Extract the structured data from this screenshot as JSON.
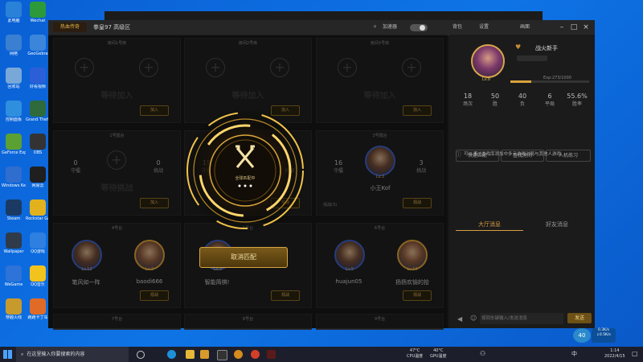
{
  "desktop": {
    "icons": [
      {
        "label": "此电脑",
        "color": "#2a82d8"
      },
      {
        "label": "Wechat",
        "color": "#2c9a3b"
      },
      {
        "label": "网络",
        "color": "#3a7fd1"
      },
      {
        "label": "GeoGebra",
        "color": "#3b86db"
      },
      {
        "label": "回收站",
        "color": "#78a8d8"
      },
      {
        "label": "好看视频",
        "color": "#2b5fd8"
      },
      {
        "label": "控制面板",
        "color": "#2f8fdf"
      },
      {
        "label": "Grand Theft Auto V",
        "color": "#2e6a3b"
      },
      {
        "label": "GeForce Experience",
        "color": "#5aa032"
      },
      {
        "label": "OBS",
        "color": "#333333"
      },
      {
        "label": "Windows Keys",
        "color": "#2f6dcf"
      },
      {
        "label": "网易云",
        "color": "#1f1f1f"
      },
      {
        "label": "Steam",
        "color": "#1b3a63"
      },
      {
        "label": "Rockstar Games",
        "color": "#e1b21d"
      },
      {
        "label": "Wallpaper",
        "color": "#2f3a4b"
      },
      {
        "label": "QQ游戏",
        "color": "#2d7fe0"
      },
      {
        "label": "WeGame",
        "color": "#2e73d8"
      },
      {
        "label": "QQ音乐",
        "color": "#f2c31d"
      },
      {
        "label": "穿越火线",
        "color": "#c79a2e"
      },
      {
        "label": "跑跑卡丁车",
        "color": "#e06b26"
      }
    ]
  },
  "app": {
    "logo": "热血传奇",
    "title": "拳皇97 高级区",
    "toolbar": {
      "accelerator": "加速器",
      "backpack": "背包",
      "settings": "设置",
      "screen": "画面"
    },
    "slots": [
      {
        "title": "房间1号房",
        "kind": "empty",
        "wait": "等待加入",
        "join": "加入"
      },
      {
        "title": "房间2号房",
        "kind": "empty",
        "wait": "等待加入",
        "join": "加入"
      },
      {
        "title": "房间3号房",
        "kind": "empty",
        "wait": "等待加入",
        "join": "加入"
      },
      {
        "title": "1号擂台",
        "kind": "stats",
        "left": "0",
        "left_label": "守擂",
        "right": "0",
        "right_label": "挑战",
        "wait": "等待挑战",
        "join": "加入"
      },
      {
        "title": "2号擂台",
        "kind": "stats",
        "left": "15",
        "left_label": "守擂",
        "right": "2",
        "right_label": "挑战",
        "wait": "",
        "join": "观战"
      },
      {
        "title": "3号擂台",
        "kind": "stats-avatar",
        "left": "16",
        "left_label": "守擂",
        "right": "3",
        "right_label": "挑战",
        "player": "小王Kof",
        "lv": "Lv.3",
        "join": "观战",
        "tag": "观战(3)"
      },
      {
        "title": "4号台",
        "kind": "duel",
        "p1": "笔风如一阵",
        "p1lv": "Lv.12",
        "p2": "baodi666",
        "p2lv": "Lv.2",
        "join": "观战"
      },
      {
        "title": "5号台",
        "kind": "duel",
        "p1": "",
        "p1lv": "Lv.3",
        "p2": "",
        "p2lv": "",
        "p1name": "智能简棋!",
        "join": "观战"
      },
      {
        "title": "6号台",
        "kind": "duel",
        "p1": "huajun05",
        "p1lv": "Lv.5",
        "p2": "扬扬欢愉的拾",
        "p2lv": "Lv.16",
        "join": "观战"
      },
      {
        "title": "7号台",
        "kind": "bottom"
      },
      {
        "title": "8号台",
        "kind": "bottom"
      },
      {
        "title": "9号台",
        "kind": "bottom"
      }
    ],
    "matching": {
      "status": "全球匹配中",
      "cancel": "取消匹配"
    },
    "profile": {
      "name": "战火新手",
      "lv": "Lv.8",
      "exp": "Exp:273/1000",
      "exp_fraction": 0.27,
      "stats": [
        {
          "value": "18",
          "label": "场次"
        },
        {
          "value": "50",
          "label": "胜"
        },
        {
          "value": "40",
          "label": "负"
        },
        {
          "value": "6",
          "label": "平局"
        },
        {
          "value": "55.6%",
          "label": "胜率"
        }
      ],
      "buttons": [
        "快速匹配",
        "查找房间",
        "人机练习"
      ],
      "tabs": [
        "大厅消息",
        "好友消息"
      ],
      "notice": "可以通过游戏库添加中多元游戏对局与其他人游戏",
      "input_placeholder": "按回车键输入/发送消息",
      "send": "发送"
    }
  },
  "taskbar": {
    "search": "在这里输入你要搜索的内容",
    "cpu1": "47°C\nCPU温度",
    "cpu2": "40°C\nGPU温度",
    "time": "1:14",
    "date": "2022/4/15",
    "ime": "中",
    "badge": "40",
    "net": "0.3K/s\n↓0.5K/s"
  }
}
